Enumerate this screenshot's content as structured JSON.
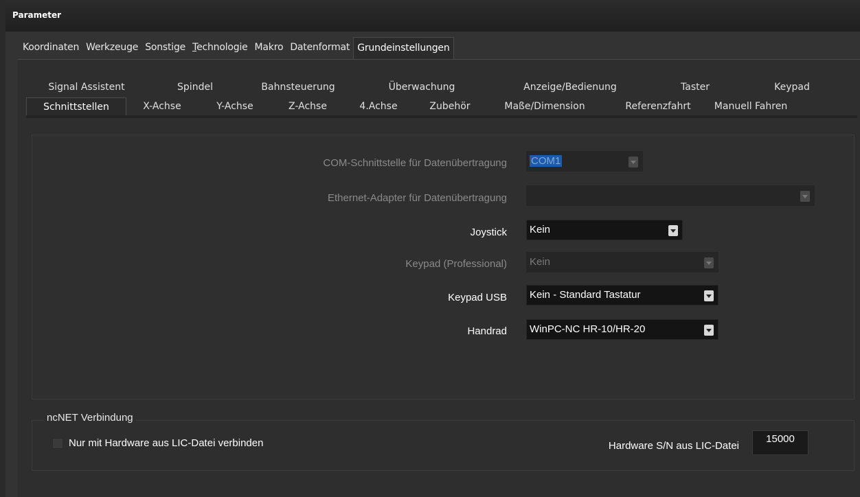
{
  "window": {
    "title": "Parameter"
  },
  "main_tabs": [
    {
      "label": "Koordinaten",
      "active": false
    },
    {
      "label": "Werkzeuge",
      "active": false
    },
    {
      "label": "Sonstige",
      "active": false
    },
    {
      "label": "Technologie",
      "active": false,
      "mnemonic": "T"
    },
    {
      "label": "Makro",
      "active": false
    },
    {
      "label": "Datenformat",
      "active": false
    },
    {
      "label": "Grundeinstellungen",
      "active": true
    }
  ],
  "sub_tabs_row1": [
    {
      "label": "Signal Assistent"
    },
    {
      "label": "Spindel"
    },
    {
      "label": "Bahnsteuerung"
    },
    {
      "label": "Überwachung"
    },
    {
      "label": "Anzeige/Bedienung"
    },
    {
      "label": "Taster"
    },
    {
      "label": "Keypad"
    }
  ],
  "sub_tabs_row2": [
    {
      "label": "Schnittstellen",
      "active": true
    },
    {
      "label": "X-Achse",
      "active": false
    },
    {
      "label": "Y-Achse",
      "active": false
    },
    {
      "label": "Z-Achse",
      "active": false
    },
    {
      "label": "4.Achse",
      "active": false
    },
    {
      "label": "Zubehör",
      "active": false
    },
    {
      "label": "Maße/Dimension",
      "active": false
    },
    {
      "label": "Referenzfahrt",
      "active": false
    },
    {
      "label": "Manuell Fahren",
      "active": false
    }
  ],
  "fields": {
    "com": {
      "label": "COM-Schnittstelle für Datenübertragung",
      "value": "COM1",
      "enabled": false
    },
    "ethernet": {
      "label": "Ethernet-Adapter für Datenübertragung",
      "value": "",
      "enabled": false
    },
    "joystick": {
      "label": "Joystick",
      "value": "Kein",
      "enabled": true
    },
    "keypad_pro": {
      "label": "Keypad (Professional)",
      "value": "Kein",
      "enabled": false
    },
    "keypad_usb": {
      "label": "Keypad USB",
      "value": "Kein - Standard Tastatur",
      "enabled": true
    },
    "handrad": {
      "label": "Handrad",
      "value": "WinPC-NC HR-10/HR-20",
      "enabled": true
    }
  },
  "ncnet": {
    "group_label": "ncNET Verbindung",
    "checkbox_label": "Nur mit Hardware aus LIC-Datei verbinden",
    "checkbox_checked": false,
    "sn_label": "Hardware S/N aus LIC-Datei",
    "sn_value": "15000"
  }
}
